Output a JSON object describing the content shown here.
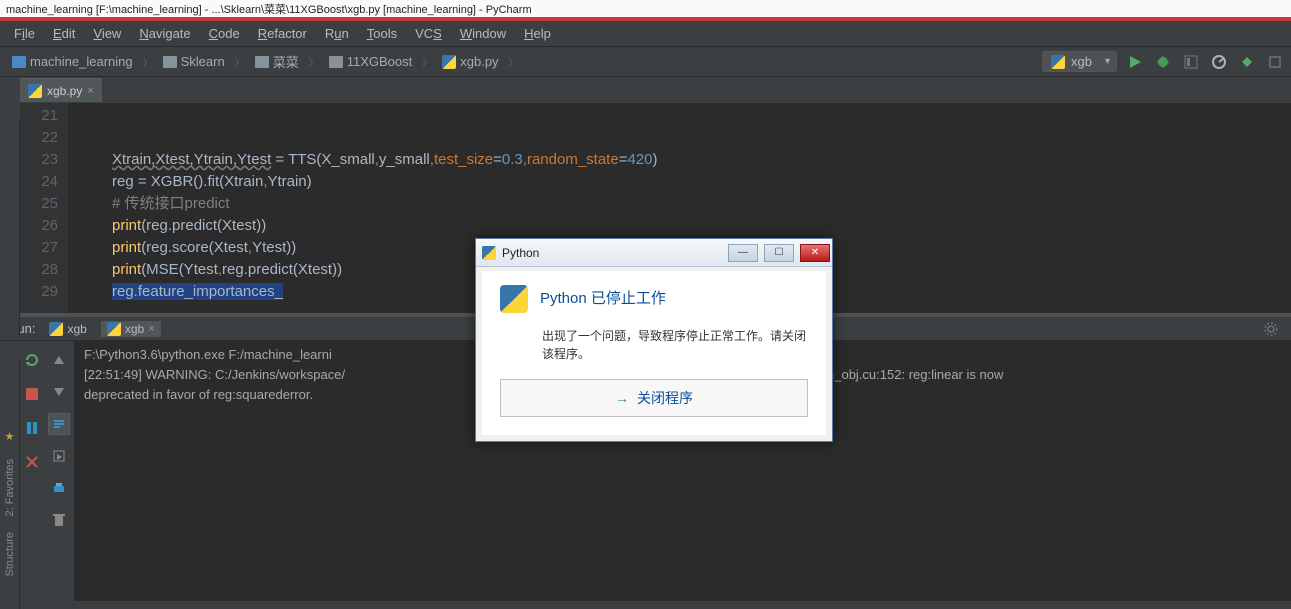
{
  "titlebar": "machine_learning [F:\\machine_learning] - ...\\Sklearn\\菜菜\\11XGBoost\\xgb.py [machine_learning] - PyCharm",
  "menus": {
    "file": "File",
    "edit": "Edit",
    "view": "View",
    "navigate": "Navigate",
    "code": "Code",
    "refactor": "Refactor",
    "run": "Run",
    "tools": "Tools",
    "vcs": "VCS",
    "window": "Window",
    "help": "Help"
  },
  "breadcrumbs": [
    {
      "label": "machine_learning",
      "icon": "folder-blue"
    },
    {
      "label": "Sklearn",
      "icon": "folder"
    },
    {
      "label": "菜菜",
      "icon": "folder"
    },
    {
      "label": "11XGBoost",
      "icon": "folder"
    },
    {
      "label": "xgb.py",
      "icon": "py"
    }
  ],
  "run_config": "xgb",
  "editor_tab": {
    "label": "xgb.py"
  },
  "line_numbers": [
    "21",
    "22",
    "23",
    "24",
    "25",
    "26",
    "27",
    "28",
    "29"
  ],
  "code": {
    "l23_ids": "Xtrain,Xtest,Ytrain,Ytest",
    "l23_eq": " = TTS(X_small",
    "l23_c1": ",",
    "l23_ys": "y_small",
    "l23_c2": ",",
    "l23_ts": "test_size",
    "l23_tseq": "=",
    "l23_tsv": "0.3",
    "l23_c3": ",",
    "l23_rs": "random_state",
    "l23_rseq": "=",
    "l23_rsv": "420",
    "l23_end": ")",
    "l24": "reg = XGBR().fit(Xtrain",
    "l24_c": ",",
    "l24_b": "Ytrain)",
    "l25": "# 传统接口predict",
    "l26_a": "print",
    "l26_b": "(reg.predict(Xtest))",
    "l27_a": "print",
    "l27_b": "(reg.score(Xtest",
    "l27_c": ",",
    "l27_d": "Ytest))",
    "l28_a": "print",
    "l28_b": "(MSE(Ytest",
    "l28_c": ",",
    "l28_d": "reg.predict(Xtest))",
    "l29": "reg.feature_importances_"
  },
  "run": {
    "label": "Run:",
    "tab1": "xgb",
    "tab2": "xgb",
    "out1": "F:\\Python3.6\\python.exe F:/machine_learni",
    "out2a": "[22:51:49] WARNING: C:/Jenkins/workspace/",
    "out2b": "/regression_obj.cu:152: reg:linear is now",
    "out3": " deprecated in favor of reg:squarederror."
  },
  "dialog": {
    "title": "Python",
    "heading": "Python 已停止工作",
    "message": "出现了一个问题，导致程序停止正常工作。请关闭该程序。",
    "button": "关闭程序"
  },
  "sidetabs": {
    "favorites": "2: Favorites",
    "structure": "Structure"
  }
}
